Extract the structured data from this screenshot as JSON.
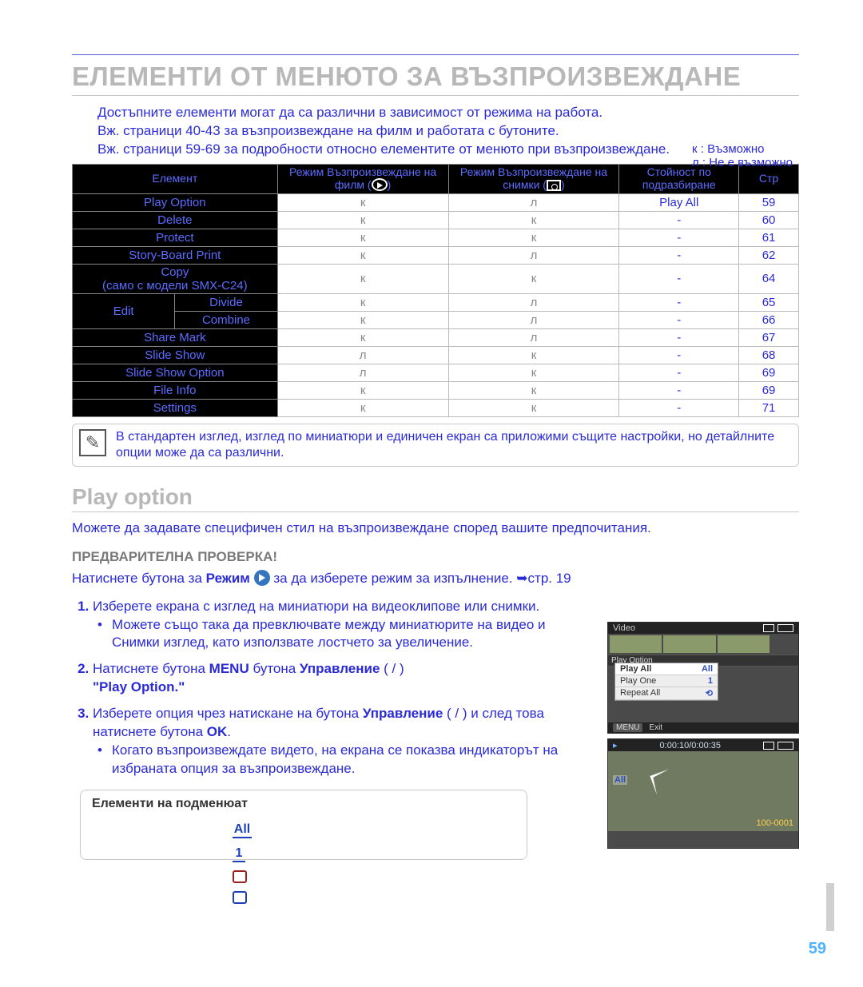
{
  "page_title": "ЕЛЕМЕНТИ ОТ МЕНЮТО ЗА ВЪЗПРОИЗВЕЖДАНЕ",
  "bullets": [
    "Достъпните елементи могат да са различни в зависимост от режима на работа.",
    "Вж. страници 40-43 за възпроизвеждане на филм и работата с бутоните.",
    "Вж. страници 59-69 за подробности относно елементите от менюто при възпроизвеждане."
  ],
  "legend": {
    "possible": "к  : Възможно",
    "not_possible": "л  : Не е възможно"
  },
  "table": {
    "headers": {
      "element": "Елемент",
      "film": "Режим Възпроизвеждане на филм (",
      "photo": "Режим Възпроизвеждане на снимки (",
      "default": "Стойност по подразбиране",
      "page": "Стр"
    },
    "rows": [
      {
        "name": "Play Option",
        "film": "к",
        "photo": "л",
        "def": "Play All",
        "pg": "59"
      },
      {
        "name": "Delete",
        "film": "к",
        "photo": "к",
        "def": "-",
        "pg": "60"
      },
      {
        "name": "Protect",
        "film": "к",
        "photo": "к",
        "def": "-",
        "pg": "61"
      },
      {
        "name": "Story-Board Print",
        "film": "к",
        "photo": "л",
        "def": "-",
        "pg": "62"
      },
      {
        "name": "Copy\n(само с модели SMX-C24)",
        "film": "к",
        "photo": "к",
        "def": "-",
        "pg": "64"
      },
      {
        "name_group": "Edit",
        "sub": "Divide",
        "film": "к",
        "photo": "л",
        "def": "-",
        "pg": "65"
      },
      {
        "name_group": "",
        "sub": "Combine",
        "film": "к",
        "photo": "л",
        "def": "-",
        "pg": "66"
      },
      {
        "name": "Share Mark",
        "film": "к",
        "photo": "л",
        "def": "-",
        "pg": "67"
      },
      {
        "name": "Slide Show",
        "film": "л",
        "photo": "к",
        "def": "-",
        "pg": "68"
      },
      {
        "name": "Slide Show Option",
        "film": "л",
        "photo": "к",
        "def": "-",
        "pg": "69"
      },
      {
        "name": "File Info",
        "film": "к",
        "photo": "к",
        "def": "-",
        "pg": "69"
      },
      {
        "name": "Settings",
        "film": "к",
        "photo": "к",
        "def": "-",
        "pg": "71"
      }
    ]
  },
  "note": "В стандартен изглед, изглед по миниатюри и единичен екран са приложими същите настройки, но детайлните опции може да са различни.",
  "section_title": "Play option",
  "lead": "Можете да задавате специфичен стил на възпроизвеждане според вашите предпочитания.",
  "precheck_label": "ПРЕДВАРИТЕЛНА ПРОВЕРКА!",
  "precheck_pre": "Натиснете бутона за ",
  "precheck_bold": "Режим",
  "precheck_post": " за да изберете режим за изпълнение. ➥стр. 19",
  "steps": {
    "s1": "Изберете екрана с изглед на миниатюри на видеоклипове или снимки.",
    "s1sub": "Можете също така да превключвате между миниатюрите на видео и Снимки изглед, като използвате лостчето за увеличение.",
    "s2_a": "Натиснете бутона ",
    "s2_menu": "MENU",
    "s2_b": "       бутона ",
    "s2_ctrl": "Управление",
    "s2_c": " (     /     )",
    "s2_quote": "\"Play Option.\"",
    "s3_a": "Изберете опция чрез натискане на бутона ",
    "s3_ctrl": "Управление",
    "s3_b": " (       /       ) и след това натиснете бутона ",
    "s3_ok": "OK",
    "s3_c": ".",
    "s3sub": "Когато възпроизвеждате видето, на екрана се показва индикаторът на избраната опция за възпроизвеждане."
  },
  "submenu_title": "Елементи на подменюат",
  "screenshot1": {
    "topbar_left": "Video",
    "menu_strip": "Play Option",
    "popup": [
      {
        "label": "Play All",
        "ic": "All"
      },
      {
        "label": "Play One",
        "ic": "1"
      },
      {
        "label": "Repeat All",
        "ic": "⟲"
      }
    ],
    "bottombar_menu": "MENU",
    "bottombar_exit": "Exit"
  },
  "screenshot2": {
    "time": "0:00:10/0:00:35",
    "all": "All",
    "clip": "100-0001"
  },
  "page_number": "59"
}
